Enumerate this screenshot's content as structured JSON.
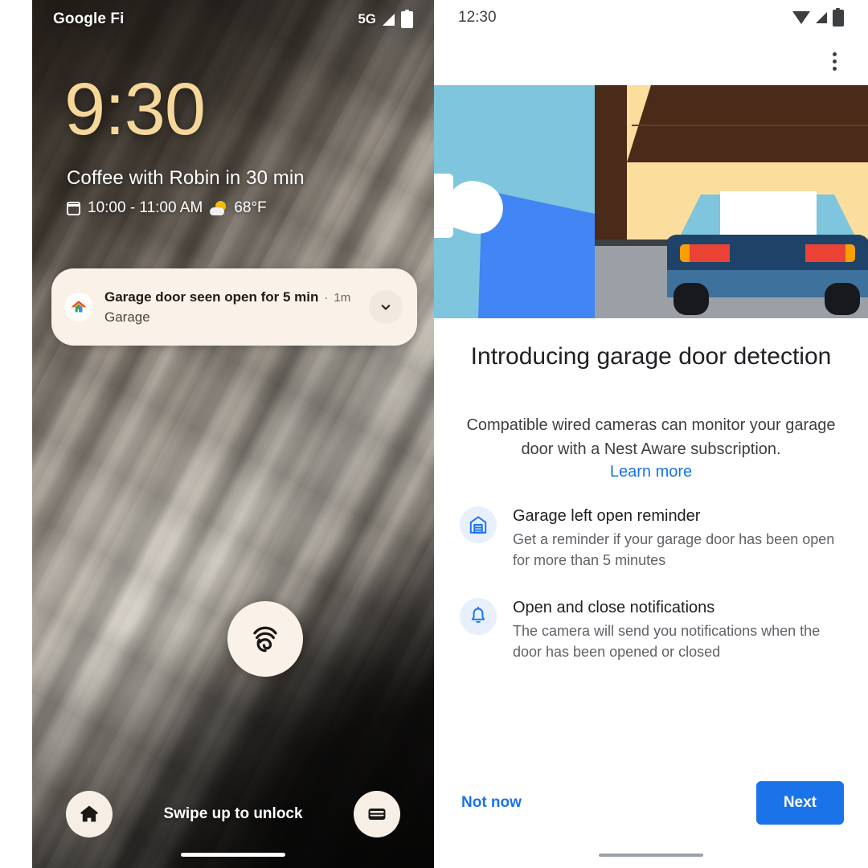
{
  "lock_screen": {
    "status_bar": {
      "carrier": "Google Fi",
      "network": "5G",
      "signal_icon": "signal-bars-icon",
      "battery_icon": "battery-icon"
    },
    "clock": "9:30",
    "event": {
      "title": "Coffee with Robin in 30 min",
      "calendar_icon": "calendar-icon",
      "time_range": "10:00 - 11:00 AM",
      "weather_icon": "sun-behind-cloud-icon",
      "temperature": "68°F"
    },
    "notification": {
      "app_icon": "google-home-icon",
      "title": "Garage door seen open for 5 min",
      "separator": "·",
      "time": "1m",
      "subtitle": "Garage",
      "expand_icon": "chevron-down-icon"
    },
    "fingerprint_icon": "fingerprint-icon",
    "bottom": {
      "left_shortcut_icon": "home-shortcut-icon",
      "hint": "Swipe up to unlock",
      "right_shortcut_icon": "wallet-icon"
    }
  },
  "app_screen": {
    "status_bar": {
      "time": "12:30",
      "wifi_icon": "wifi-icon",
      "signal_icon": "signal-bars-icon",
      "battery_icon": "battery-icon"
    },
    "overflow_icon": "more-vertical-icon",
    "illustration": {
      "name": "garage-door-camera-illustration",
      "elements": [
        "sky",
        "wired-camera",
        "vision-cone",
        "garage-door-frame",
        "raised-garage-door",
        "parked-car",
        "driveway"
      ],
      "colors": {
        "sky": "#7ec5dd",
        "cone": "#4285f4",
        "door_frame": "#4a2a18",
        "door_panel": "#4a2a18",
        "interior": "#fbde9d",
        "ground": "#9aa0a6",
        "car_body": "#1f4269",
        "car_lower": "#3e719b",
        "taillight_red": "#ea4335",
        "taillight_amber": "#fa9f08"
      }
    },
    "title": "Introducing garage door detection",
    "body": "Compatible wired cameras can monitor your garage door with a Nest Aware subscription.",
    "learn_more": "Learn more",
    "features": [
      {
        "icon": "garage-icon",
        "title": "Garage left open reminder",
        "description": "Get a reminder if your garage door has been open for more than 5 minutes"
      },
      {
        "icon": "bell-icon",
        "title": "Open and close notifications",
        "description": "The camera will send you notifications when the door has been opened or closed"
      }
    ],
    "footer": {
      "secondary_label": "Not now",
      "primary_label": "Next"
    },
    "colors": {
      "accent": "#1a73e8",
      "icon_bg": "#e8f0fe",
      "text_primary": "#202124",
      "text_secondary": "#5f6368"
    }
  }
}
